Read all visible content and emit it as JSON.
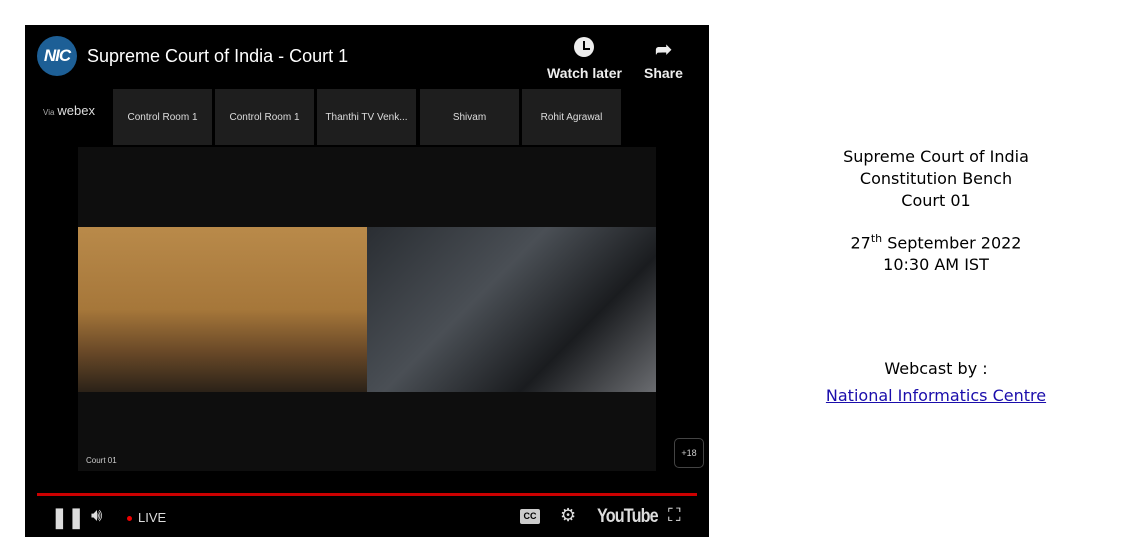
{
  "player": {
    "title": "Supreme Court of India - Court 1",
    "logo_text": "NIC",
    "watch_later": "Watch later",
    "share": "Share",
    "via": "Via",
    "webex": "webex",
    "participants": [
      "Control Room 1",
      "Control Room 1",
      "Thanthi TV Venk...",
      "Shivam",
      "Rohit Agrawal"
    ],
    "stage_label": "Court 01",
    "more_count": "+18",
    "live": "LIVE",
    "cc": "CC",
    "youtube": "YouTube",
    "progress_percent": 100,
    "accent": "#cc0000"
  },
  "info": {
    "line1": "Supreme Court of India",
    "line2": "Constitution Bench",
    "line3": "Court 01",
    "date_day": "27",
    "date_sup": "th",
    "date_rest": " September 2022",
    "time": "10:30 AM IST",
    "webcast_by": "Webcast by :",
    "link": "National Informatics Centre"
  }
}
